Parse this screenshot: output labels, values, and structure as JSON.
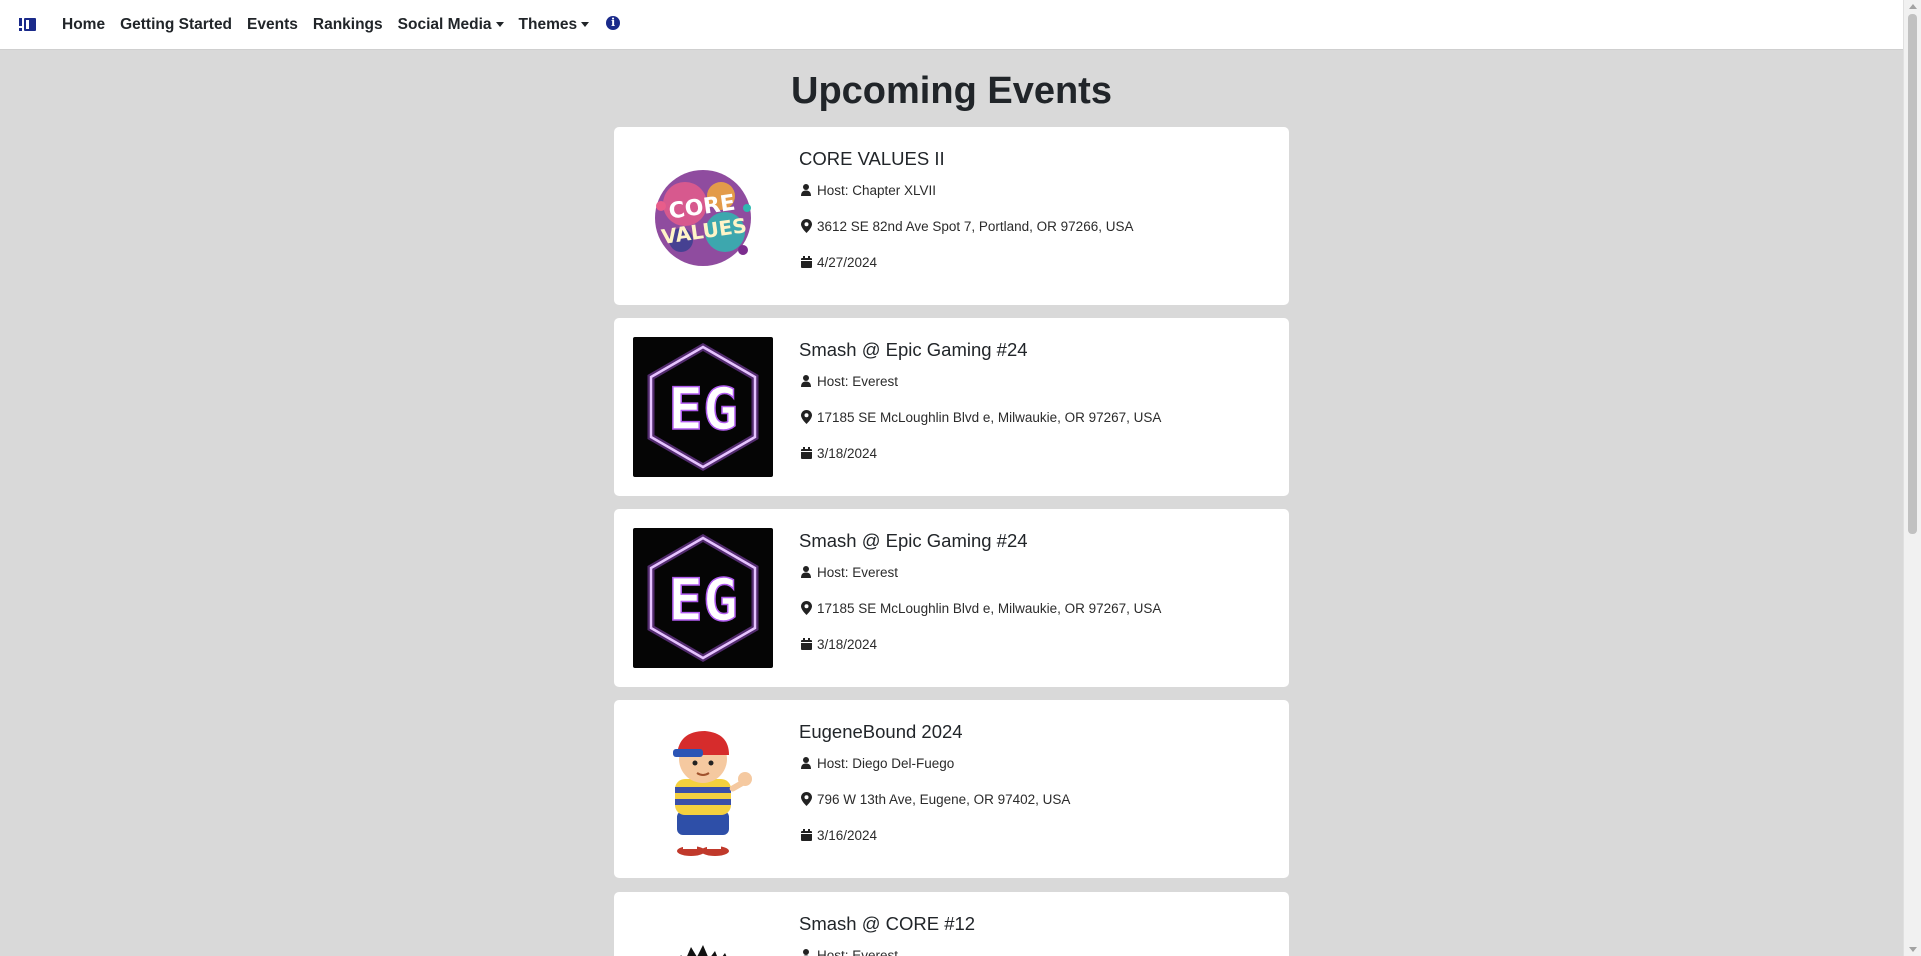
{
  "nav": {
    "brand_icon": "logo-icon",
    "home": "Home",
    "getting_started": "Getting Started",
    "events": "Events",
    "rankings": "Rankings",
    "social_media": "Social Media",
    "themes": "Themes",
    "info_icon": "info-circle-icon"
  },
  "page": {
    "title": "Upcoming Events"
  },
  "events": [
    {
      "title": "CORE VALUES II",
      "host": "Host: Chapter XLVII",
      "address": "3612 SE 82nd Ave Spot 7, Portland, OR 97266, USA",
      "date": "4/27/2024",
      "image": "core-values-logo"
    },
    {
      "title": "Smash @ Epic Gaming #24",
      "host": "Host: Everest",
      "address": "17185 SE McLoughlin Blvd e, Milwaukie, OR 97267, USA",
      "date": "3/18/2024",
      "image": "epic-gaming-logo"
    },
    {
      "title": "Smash @ Epic Gaming #24",
      "host": "Host: Everest",
      "address": "17185 SE McLoughlin Blvd e, Milwaukie, OR 97267, USA",
      "date": "3/18/2024",
      "image": "epic-gaming-logo"
    },
    {
      "title": "EugeneBound 2024",
      "host": "Host: Diego Del-Fuego",
      "address": "796 W 13th Ave, Eugene, OR 97402, USA",
      "date": "3/16/2024",
      "image": "ness-character"
    },
    {
      "title": "Smash @ CORE #12",
      "host": "Host: Everest",
      "image": "core-flame-logo"
    }
  ],
  "colors": {
    "background": "#d9d9d9",
    "card": "#ffffff",
    "brand": "#1a2a8a",
    "eg_purple": "#b15cf0"
  }
}
